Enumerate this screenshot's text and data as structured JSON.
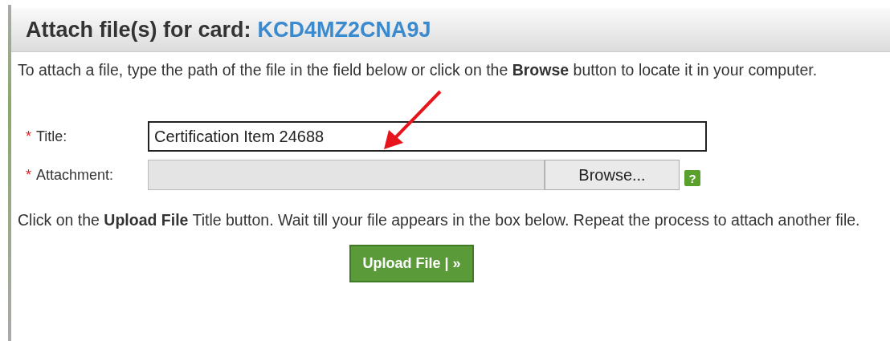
{
  "dialog": {
    "title": "Attach file(s) for card:",
    "card_id": "KCD4MZ2CNA9J"
  },
  "intro": "To attach a file, type the path of the file in the field below or click on the **Browse** button to locate it in your computer.",
  "fields": [
    {
      "kind": "text",
      "marker": "*",
      "label": "Title:",
      "value": "Certification Item 24688"
    },
    {
      "kind": "file",
      "marker": "*",
      "label": "Attachment:",
      "button": "Browse...",
      "help": "?"
    }
  ],
  "instructions": "Click on the **Upload File** Title button. Wait till your file appears in the box below. Repeat the process to attach another file.",
  "upload_button": "Upload File | »"
}
